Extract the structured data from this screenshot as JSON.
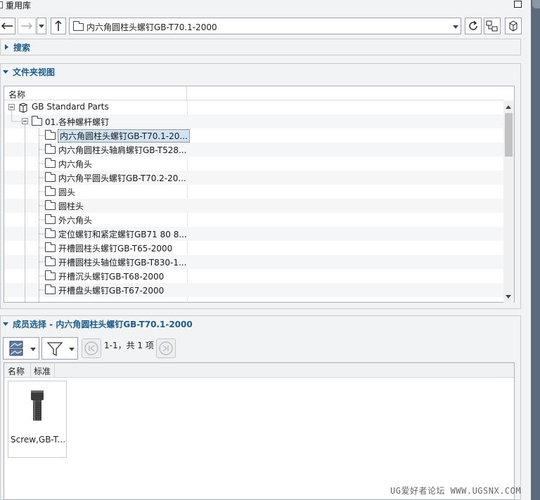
{
  "window": {
    "title": "重用库"
  },
  "address_bar": {
    "path": "内六角圆柱头螺钉GB-T70.1-2000"
  },
  "search_section": {
    "title": "搜索"
  },
  "folder_view": {
    "title": "文件夹视图",
    "column_header": "名称",
    "root": "GB Standard Parts",
    "group": "01.各种螺杆螺钉",
    "items": [
      "内六角圆柱头螺钉GB-T70.1-20...",
      "内六角圆柱头轴肩螺钉GB-T528...",
      "内六角头",
      "内六角平圆头螺钉GB-T70.2-20...",
      "圆头",
      "圆柱头",
      "外六角头",
      "定位螺钉和紧定螺钉GB71 80 8...",
      "开槽圆柱头螺钉GB-T65-2000",
      "开槽圆柱头轴位螺钉GB-T830-1...",
      "开槽沉头螺钉GB-T68-2000",
      "开槽盘头螺钉GB-T67-2000"
    ],
    "selected_index": 0
  },
  "member_select": {
    "title": "成员选择 - 内六角圆柱头螺钉GB-T70.1-2000",
    "page_info": "1-1，共 1 项",
    "columns": [
      "名称",
      "标准"
    ],
    "results": [
      {
        "name": "Screw,GB-T..."
      }
    ]
  },
  "watermark": "UG爱好者论坛 WWW.UGSNX.COM"
}
